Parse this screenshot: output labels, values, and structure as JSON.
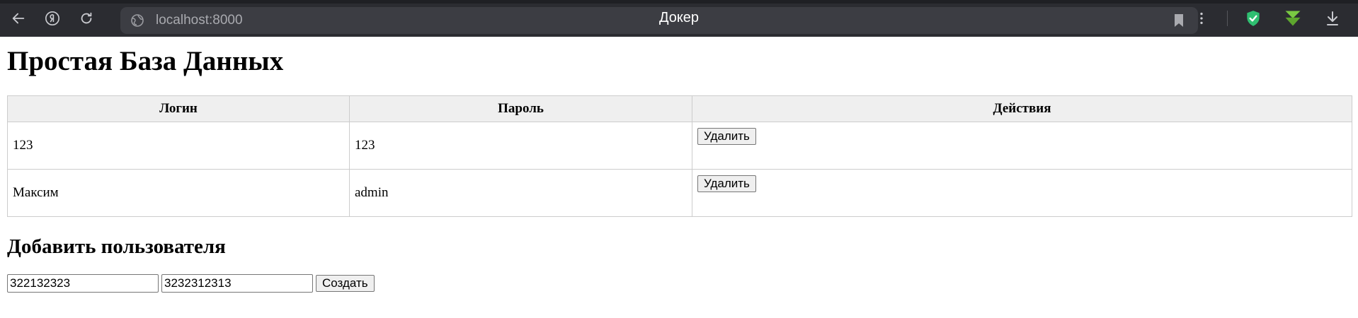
{
  "browser": {
    "tab_title": "Докер",
    "url": "localhost:8000"
  },
  "page": {
    "heading": "Простая База Данных",
    "table": {
      "headers": [
        "Логин",
        "Пароль",
        "Действия"
      ],
      "rows": [
        {
          "login": "123",
          "password": "123",
          "action": "Удалить"
        },
        {
          "login": "Максим",
          "password": "admin",
          "action": "Удалить"
        }
      ]
    },
    "add_section": {
      "heading": "Добавить пользователя",
      "login_value": "322132323",
      "password_value": "3232312313",
      "submit_label": "Создать"
    }
  },
  "colors": {
    "chrome_bg": "#2b2c31",
    "address_bg": "#3c3d43",
    "shield_green": "#2fbf71",
    "download_green": "#7ac943",
    "header_bg": "#efefef"
  }
}
